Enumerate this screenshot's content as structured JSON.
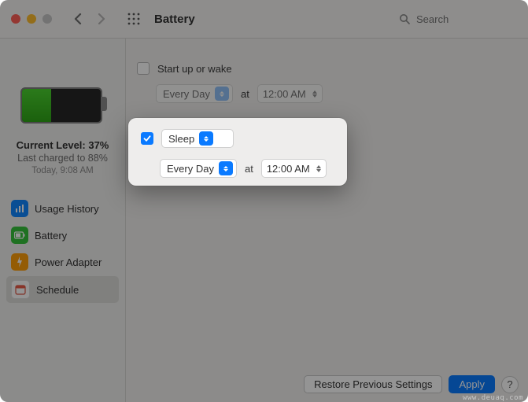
{
  "titlebar": {
    "title": "Battery",
    "search_placeholder": "Search"
  },
  "sidebar": {
    "level_label": "Current Level: 37%",
    "last_charged": "Last charged to 88%",
    "last_time": "Today, 9:08 AM",
    "items": [
      {
        "label": "Usage History"
      },
      {
        "label": "Battery"
      },
      {
        "label": "Power Adapter"
      },
      {
        "label": "Schedule"
      }
    ]
  },
  "startup": {
    "label": "Start up or wake",
    "frequency": "Every Day",
    "at_label": "at",
    "time": "12:00 AM"
  },
  "panel": {
    "action": "Sleep",
    "frequency": "Every Day",
    "at_label": "at",
    "time": "12:00 AM"
  },
  "footer": {
    "restore": "Restore Previous Settings",
    "apply": "Apply",
    "help": "?"
  },
  "watermark": "www.deuaq.com"
}
